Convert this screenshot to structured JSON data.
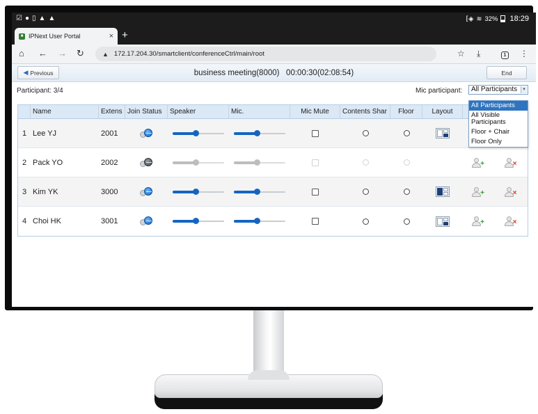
{
  "statusbar": {
    "left_icons": [
      "☑",
      "●",
      "▯",
      "▲",
      "▲"
    ],
    "signal": "⁅◈",
    "wifi": "≋",
    "battery_percent": "32%",
    "clock": "18:29"
  },
  "browser": {
    "tab_title": "IPNext User Portal",
    "tab_close": "×",
    "new_tab": "+",
    "url": "172.17.204.30/smartclient/conferenceCtrl/main/root",
    "tab_count": "1"
  },
  "header": {
    "previous_label": "Previous",
    "meeting_title": "business meeting(8000)   00:00:30(02:08:54)",
    "end_label": "End"
  },
  "subbar": {
    "participant_count": "Participant: 3/4",
    "mic_label": "Mic participant:",
    "mic_selected": "All Participants"
  },
  "mic_options": [
    "All Participants",
    "All Visible Participants",
    "Floor + Chair",
    "Floor Only"
  ],
  "columns": {
    "name": "Name",
    "ext": "Extens",
    "join": "Join Status",
    "speaker": "Speaker",
    "mic": "Mic.",
    "mute": "Mic Mute",
    "contents": "Contents Shar",
    "floor": "Floor",
    "layout": "Layout"
  },
  "rows": [
    {
      "no": "1",
      "name": "Lee YJ",
      "ext": "2001",
      "active": true,
      "speaker_level": 0.45,
      "mic_level": 0.45,
      "layout": "l1",
      "actions": false
    },
    {
      "no": "2",
      "name": "Pack YO",
      "ext": "2002",
      "active": false,
      "speaker_level": 0.45,
      "mic_level": 0.45,
      "layout": "none",
      "actions": true
    },
    {
      "no": "3",
      "name": "Kim YK",
      "ext": "3000",
      "active": true,
      "speaker_level": 0.45,
      "mic_level": 0.45,
      "layout": "l2",
      "actions": true
    },
    {
      "no": "4",
      "name": "Choi HK",
      "ext": "3001",
      "active": true,
      "speaker_level": 0.45,
      "mic_level": 0.45,
      "layout": "l1",
      "actions": true
    }
  ]
}
